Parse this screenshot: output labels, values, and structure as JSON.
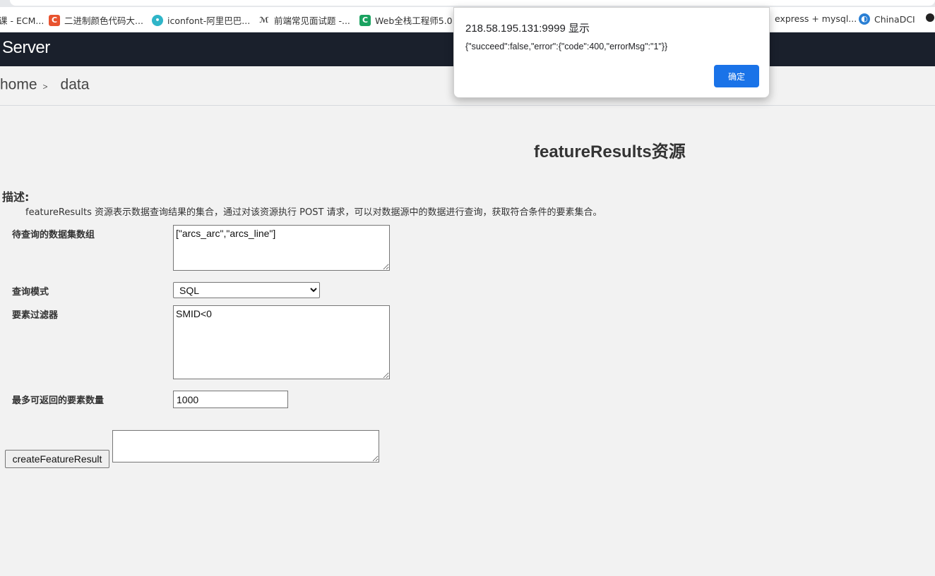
{
  "bookmarks": [
    {
      "label": "课 - ECM...",
      "icon": "page-icon",
      "color": ""
    },
    {
      "label": "二进制颜色代码大...",
      "icon": "c-logo-icon",
      "color": "#e8532f"
    },
    {
      "label": "iconfont-阿里巴巴...",
      "icon": "iconfont-logo-icon",
      "color": "#2fb5c8"
    },
    {
      "label": "前端常见面试题 -...",
      "icon": "cat-logo-icon",
      "color": ""
    },
    {
      "label": "Web全栈工程师5.0...",
      "icon": "c-logo-icon",
      "color": "#1aa260"
    },
    {
      "label": "express + mysql...",
      "icon": "page-icon",
      "color": ""
    },
    {
      "label": "ChinaDCI",
      "icon": "globe-icon",
      "color": "#2a7fd4"
    }
  ],
  "header": {
    "logo_text": "Server",
    "bg_color": "#1a202c"
  },
  "breadcrumb": {
    "home": "home",
    "separator": ">",
    "current": "data"
  },
  "page": {
    "title": "featureResults资源",
    "desc_label": "描述:",
    "desc_text": "featureResults 资源表示数据查询结果的集合，通过对该资源执行 POST 请求，可以对数据源中的数据进行查询，获取符合条件的要素集合。"
  },
  "form": {
    "datasets_label": "待查询的数据集数组",
    "datasets_value": "[\"arcs_arc\",\"arcs_line\"]",
    "mode_label": "查询模式",
    "mode_value": "SQL",
    "filter_label": "要素过滤器",
    "filter_value": "SMID<0",
    "max_label": "最多可返回的要素数量",
    "max_value": "1000",
    "submit_label": "createFeatureResult",
    "result_value": ""
  },
  "dialog": {
    "origin": "218.58.195.131:9999 显示",
    "message": "{\"succeed\":false,\"error\":{\"code\":400,\"errorMsg\":\"1\"}}",
    "ok_label": "确定",
    "accent_color": "#1a73e8"
  }
}
